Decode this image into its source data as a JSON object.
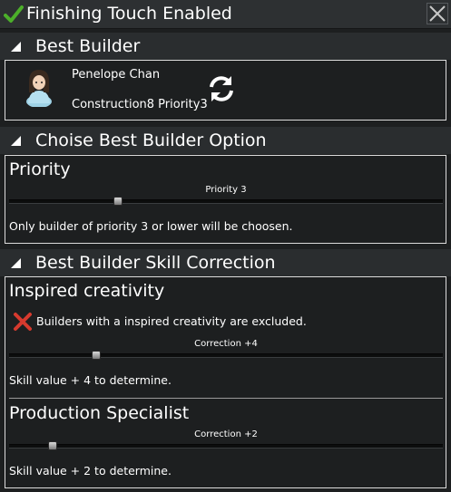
{
  "window": {
    "title": "Finishing Touch Enabled",
    "colors": {
      "background": "#1d1f20",
      "header": "#2a2d2f",
      "text": "#ffffff",
      "check": "#4caf2a",
      "exclude": "#d63a2e"
    }
  },
  "best_builder": {
    "section_title": "Best Builder",
    "name": "Penelope Chan",
    "stats": "Construction8 Priority3"
  },
  "option": {
    "section_title": "Choise Best Builder Option",
    "priority": {
      "title": "Priority",
      "slider_label": "Priority 3",
      "slider_value": 3,
      "slider_max": 12,
      "description": "Only builder of priority 3 or lower will be choosen."
    }
  },
  "skill_correction": {
    "section_title": "Best Builder Skill Correction",
    "inspired": {
      "title": "Inspired creativity",
      "excluded_text": "Builders with a inspired creativity are excluded.",
      "slider_label": "Correction +4",
      "slider_value": 4,
      "slider_max": 20,
      "description": "Skill value + 4 to determine."
    },
    "production": {
      "title": "Production Specialist",
      "slider_label": "Correction +2",
      "slider_value": 2,
      "slider_max": 20,
      "description": "Skill value + 2 to determine."
    }
  }
}
